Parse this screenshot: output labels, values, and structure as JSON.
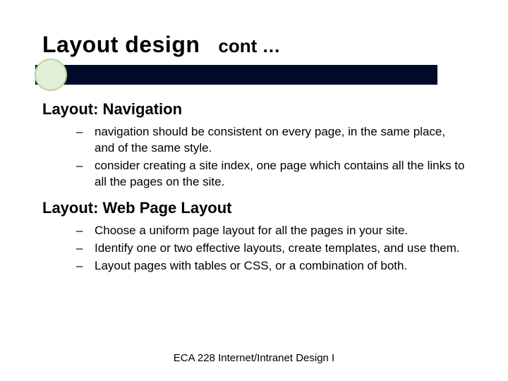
{
  "title": "Layout design",
  "subtitle": "cont …",
  "sections": [
    {
      "heading": "Layout: Navigation",
      "bullets": [
        "navigation should be consistent on every page, in the same place, and of the same style.",
        "consider creating a site index, one page which contains all the links to all the pages on the site."
      ]
    },
    {
      "heading": "Layout: Web Page Layout",
      "bullets": [
        "Choose a uniform page layout for all the pages in your site.",
        "Identify one or two effective layouts, create templates, and use them.",
        "Layout pages with tables or CSS, or a combination of both."
      ]
    }
  ],
  "footer": "ECA 228  Internet/Intranet Design I"
}
